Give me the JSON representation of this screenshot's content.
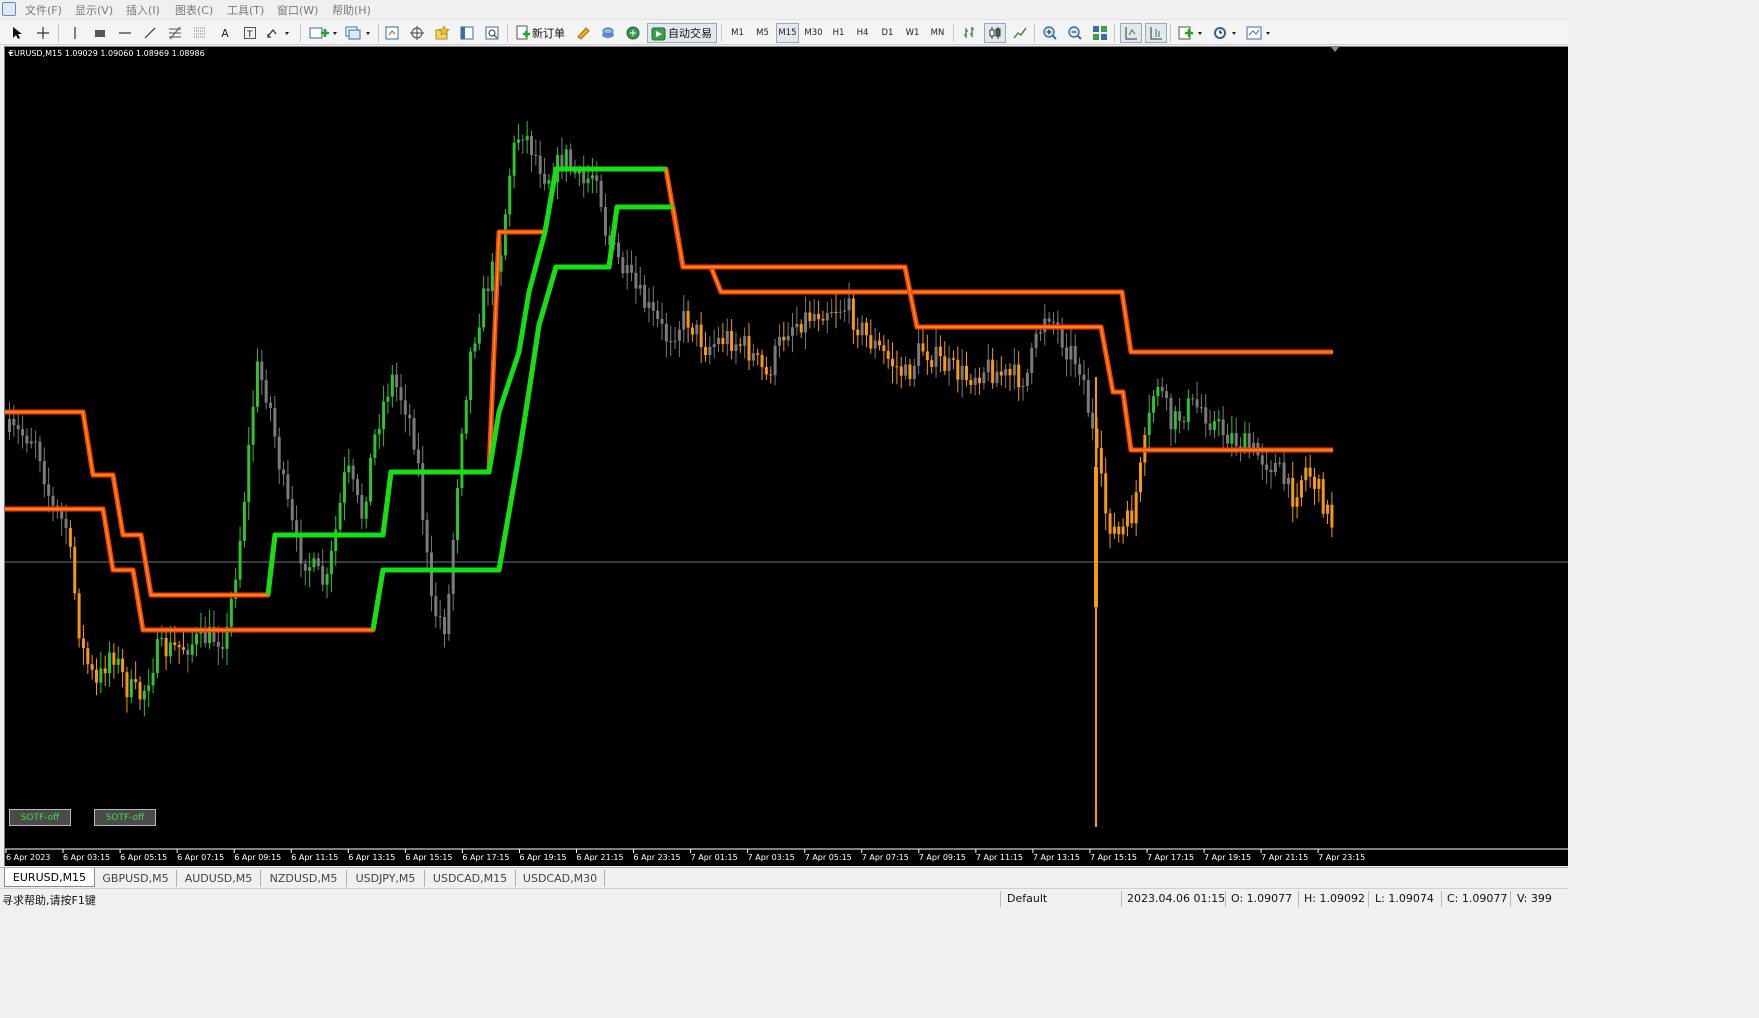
{
  "menu": {
    "items": [
      "文件(F)",
      "显示(V)",
      "插入(I)",
      "图表(C)",
      "工具(T)",
      "窗口(W)",
      "帮助(H)"
    ]
  },
  "toolbar": {
    "new_order_label": "新订单",
    "auto_trading_label": "自动交易",
    "timeframes": [
      "M1",
      "M5",
      "M15",
      "M30",
      "H1",
      "H4",
      "D1",
      "W1",
      "MN"
    ],
    "active_timeframe": "M15",
    "icons": [
      "cursor-icon",
      "crosshair-icon",
      "vertical-line-icon",
      "rectangle-icon",
      "horizontal-line-icon",
      "trendline-icon",
      "fibonacci-icon",
      "channel-icon",
      "text-icon",
      "text-label-icon",
      "arrow-icon",
      "new-chart-icon",
      "profiles-icon",
      "market-watch-icon",
      "data-window-icon",
      "navigator-icon",
      "terminal-icon",
      "strategy-tester-icon",
      "new-order-icon",
      "metaeditor-icon",
      "signals-icon",
      "auto-trading-icon",
      "bar-chart-icon",
      "candlestick-chart-icon",
      "line-chart-icon",
      "zoom-in-icon",
      "zoom-out-icon",
      "tile-windows-icon",
      "chart-shift-icon",
      "autoscroll-icon",
      "indicators-icon",
      "periods-icon",
      "templates-icon"
    ]
  },
  "chart": {
    "header": "EURUSD,M15  1.09029 1.09060 1.08969 1.08986",
    "buttons": [
      "SOTF-off",
      "SOTF-off"
    ],
    "time_axis": [
      "6 Apr 2023",
      "6 Apr 03:15",
      "6 Apr 05:15",
      "6 Apr 07:15",
      "6 Apr 09:15",
      "6 Apr 11:15",
      "6 Apr 13:15",
      "6 Apr 15:15",
      "6 Apr 17:15",
      "6 Apr 19:15",
      "6 Apr 21:15",
      "6 Apr 23:15",
      "7 Apr 01:15",
      "7 Apr 03:15",
      "7 Apr 05:15",
      "7 Apr 07:15",
      "7 Apr 09:15",
      "7 Apr 11:15",
      "7 Apr 13:15",
      "7 Apr 15:15",
      "7 Apr 17:15",
      "7 Apr 19:15",
      "7 Apr 21:15",
      "7 Apr 23:15"
    ],
    "colors": {
      "background": "#000000",
      "bull_candle": "#2fc42f",
      "bear_candle": "#f59a0e",
      "neutral_candle": "#7a7a7a",
      "resistance_band": "#ff3d1a",
      "resistance_band_inner": "#ffa000",
      "support_band": "#14e014",
      "price_line": "#5f7b86"
    }
  },
  "tabs": [
    {
      "label": "EURUSD,M15",
      "active": true
    },
    {
      "label": "GBPUSD,M5",
      "active": false
    },
    {
      "label": "AUDUSD,M5",
      "active": false
    },
    {
      "label": "NZDUSD,M5",
      "active": false
    },
    {
      "label": "USDJPY,M5",
      "active": false
    },
    {
      "label": "USDCAD,M15",
      "active": false
    },
    {
      "label": "USDCAD,M30",
      "active": false
    }
  ],
  "status": {
    "help": "寻求帮助,请按F1键",
    "profile": "Default",
    "datetime": "2023.04.06 01:15",
    "open": "O: 1.09077",
    "high": "H: 1.09092",
    "low": "L: 1.09074",
    "close": "C: 1.09077",
    "volume": "V: 399"
  }
}
